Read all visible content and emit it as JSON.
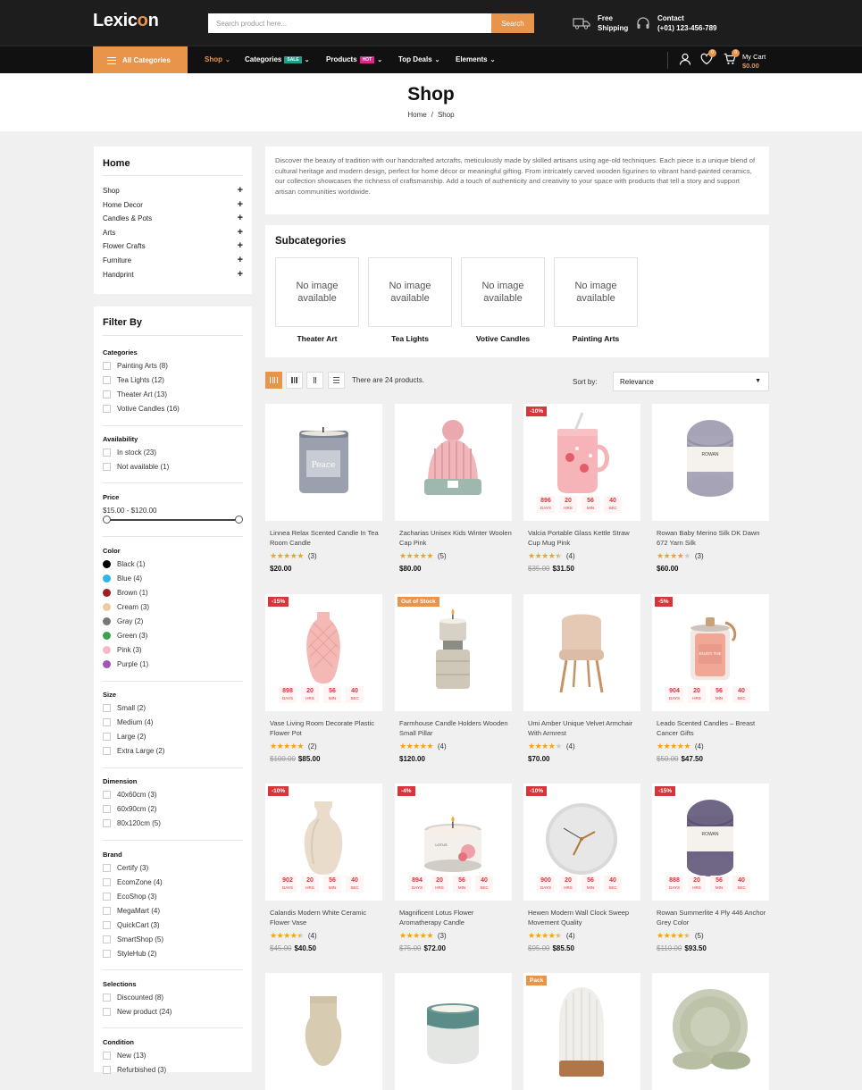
{
  "header": {
    "logo_main": "Lexic",
    "logo_accent": "o",
    "logo_end": "n",
    "search_placeholder": "Search product here...",
    "search_button": "Search",
    "ship_line1": "Free",
    "ship_line2": "Shipping",
    "contact_line1": "Contact",
    "contact_line2": "(+01) 123-456-789"
  },
  "nav": {
    "all_categories": "All Categories",
    "items": [
      {
        "label": "Shop",
        "badge": ""
      },
      {
        "label": "Categories",
        "badge": "SALE"
      },
      {
        "label": "Products",
        "badge": "HOT"
      },
      {
        "label": "Top Deals",
        "badge": ""
      },
      {
        "label": "Elements",
        "badge": ""
      }
    ],
    "wishlist_count": "0",
    "cart_count": "0",
    "cart_label": "My Cart",
    "cart_amount": "$0.00"
  },
  "page": {
    "title": "Shop",
    "breadcrumb": [
      "Home",
      "Shop"
    ]
  },
  "sidebar": {
    "home_title": "Home",
    "home_items": [
      "Shop",
      "Home Decor",
      "Candles & Pots",
      "Arts",
      "Flower Crafts",
      "Furniture",
      "Handprint"
    ],
    "filter_title": "Filter By",
    "categories_title": "Categories",
    "categories": [
      "Painting Arts (8)",
      "Tea Lights (12)",
      "Theater Art (13)",
      "Votive Candles (16)"
    ],
    "availability_title": "Availability",
    "availability": [
      "In stock (23)",
      "Not available (1)"
    ],
    "price_title": "Price",
    "price_range": "$15.00 - $120.00",
    "color_title": "Color",
    "colors": [
      {
        "label": "Black (1)",
        "hex": "#000000"
      },
      {
        "label": "Blue (4)",
        "hex": "#2fb5e8"
      },
      {
        "label": "Brown (1)",
        "hex": "#9b2020"
      },
      {
        "label": "Cream (3)",
        "hex": "#f1c9a0"
      },
      {
        "label": "Gray (2)",
        "hex": "#777777"
      },
      {
        "label": "Green (3)",
        "hex": "#3ea24c"
      },
      {
        "label": "Pink (3)",
        "hex": "#f7b9c7"
      },
      {
        "label": "Purple (1)",
        "hex": "#a054b5"
      }
    ],
    "size_title": "Size",
    "sizes": [
      "Small (2)",
      "Medium (4)",
      "Large (2)",
      "Extra Large (2)"
    ],
    "dimension_title": "Dimension",
    "dimensions": [
      "40x60cm (3)",
      "60x90cm (2)",
      "80x120cm (5)"
    ],
    "brand_title": "Brand",
    "brands": [
      "Certify (3)",
      "EcomZone (4)",
      "EcoShop (3)",
      "MegaMart (4)",
      "QuickCart (3)",
      "SmartShop (5)",
      "StyleHub (2)"
    ],
    "selections_title": "Selections",
    "selections": [
      "Discounted (8)",
      "New product (24)"
    ],
    "condition_title": "Condition",
    "conditions": [
      "New (13)",
      "Refurbished (3)"
    ]
  },
  "main": {
    "description": "Discover the beauty of tradition with our handcrafted artcrafts, meticulously made by skilled artisans using age-old techniques. Each piece is a unique blend of cultural heritage and modern design, perfect for home décor or meaningful gifting. From intricately carved wooden figurines to vibrant hand-painted ceramics, our collection showcases the richness of craftsmanship. Add a touch of authenticity and creativity to your space with products that tell a story and support artisan communities worldwide.",
    "subcategories_title": "Subcategories",
    "no_image_text": "No image available",
    "subcategories": [
      "Theater Art",
      "Tea Lights",
      "Votive Candles",
      "Painting Arts"
    ],
    "product_count": "There are 24 products.",
    "sort_label": "Sort by:",
    "sort_value": "Relevance"
  },
  "countdown_units": [
    "DAYS",
    "HRS",
    "MIN",
    "SEC"
  ],
  "products": [
    {
      "title": "Linnea Relax Scented Candle In Tea Room Candle",
      "stars": 5,
      "reviews": "(3)",
      "price": "$20.00",
      "old": "",
      "tag": "",
      "tagc": "",
      "cd": [],
      "img": "candle_peace"
    },
    {
      "title": "Zacharias Unisex Kids Winter Woolen Cap Pink",
      "stars": 5,
      "reviews": "(5)",
      "price": "$80.00",
      "old": "",
      "tag": "",
      "tagc": "",
      "cd": [],
      "img": "beanie"
    },
    {
      "title": "Valcia Portable Glass Kettle Straw Cup Mug Pink",
      "stars": 4.5,
      "reviews": "(4)",
      "price": "$31.50",
      "old": "$35.00",
      "tag": "-10%",
      "tagc": "#d9343a",
      "cd": [
        "896",
        "20",
        "56",
        "40"
      ],
      "img": "mug"
    },
    {
      "title": "Rowan Baby Merino Silk DK Dawn 672 Yarn Silk",
      "stars": 4,
      "reviews": "(3)",
      "price": "$60.00",
      "old": "",
      "tag": "",
      "tagc": "",
      "cd": [],
      "img": "yarn_light"
    },
    {
      "title": "Vase Living Room Decorate Plastic Flower Pot",
      "stars": 5,
      "reviews": "(2)",
      "price": "$85.00",
      "old": "$100.00",
      "tag": "-15%",
      "tagc": "#d9343a",
      "cd": [
        "898",
        "20",
        "56",
        "40"
      ],
      "img": "vase_pink"
    },
    {
      "title": "Farmhouse Candle Holders Wooden Small Pillar",
      "stars": 5,
      "reviews": "(4)",
      "price": "$120.00",
      "old": "",
      "tag": "Out of Stock",
      "tagc": "#e8944a",
      "cd": [],
      "img": "holder"
    },
    {
      "title": "Umi Amber Unique Velvet Armchair With Armrest",
      "stars": 4,
      "reviews": "(4)",
      "price": "$70.00",
      "old": "",
      "tag": "",
      "tagc": "",
      "cd": [],
      "img": "chair"
    },
    {
      "title": "Leado Scented Candles – Breast Cancer Gifts",
      "stars": 5,
      "reviews": "(4)",
      "price": "$47.50",
      "old": "$50.00",
      "tag": "-5%",
      "tagc": "#d9343a",
      "cd": [
        "904",
        "20",
        "56",
        "40"
      ],
      "img": "jar"
    },
    {
      "title": "Calandis Modern White Ceramic Flower Vase",
      "stars": 4.5,
      "reviews": "(4)",
      "price": "$40.50",
      "old": "$45.00",
      "tag": "-10%",
      "tagc": "#d9343a",
      "cd": [
        "902",
        "20",
        "56",
        "40"
      ],
      "img": "vase_cream"
    },
    {
      "title": "Magnificent Lotus Flower Aromatherapy Candle",
      "stars": 5,
      "reviews": "(3)",
      "price": "$72.00",
      "old": "$75.00",
      "tag": "-4%",
      "tagc": "#d9343a",
      "cd": [
        "894",
        "20",
        "56",
        "40"
      ],
      "img": "tin"
    },
    {
      "title": "Hewen Modern Wall Clock Sweep Movement Quality",
      "stars": 4.5,
      "reviews": "(4)",
      "price": "$85.50",
      "old": "$95.00",
      "tag": "-10%",
      "tagc": "#d9343a",
      "cd": [
        "900",
        "20",
        "56",
        "40"
      ],
      "img": "clock"
    },
    {
      "title": "Rowan Summerlite 4 Ply 446 Anchor Grey Color",
      "stars": 4.5,
      "reviews": "(5)",
      "price": "$93.50",
      "old": "$110.00",
      "tag": "-15%",
      "tagc": "#d9343a",
      "cd": [
        "888",
        "20",
        "56",
        "40"
      ],
      "img": "yarn_dark"
    },
    {
      "title": "",
      "stars": 0,
      "reviews": "",
      "price": "",
      "old": "",
      "tag": "",
      "tagc": "",
      "cd": [],
      "img": "vase_stone"
    },
    {
      "title": "",
      "stars": 0,
      "reviews": "",
      "price": "",
      "old": "",
      "tag": "",
      "tagc": "",
      "cd": [],
      "img": "teal_candle"
    },
    {
      "title": "",
      "stars": 0,
      "reviews": "",
      "price": "",
      "old": "",
      "tag": "Pack",
      "tagc": "#e8944a",
      "cd": [],
      "img": "lamp"
    },
    {
      "title": "",
      "stars": 0,
      "reviews": "",
      "price": "",
      "old": "",
      "tag": "",
      "tagc": "",
      "cd": [],
      "img": "plates"
    }
  ]
}
